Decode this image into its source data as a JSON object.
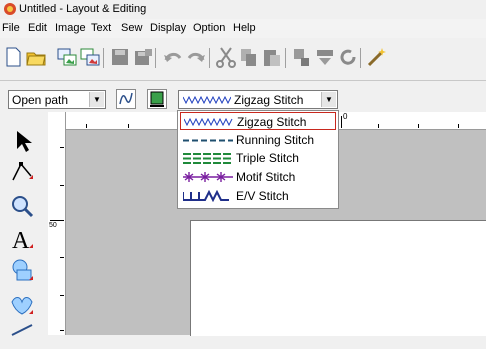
{
  "window": {
    "title": "Untitled - Layout & Editing"
  },
  "menu": [
    "File",
    "Edit",
    "Image",
    "Text",
    "Sew",
    "Display",
    "Option",
    "Help"
  ],
  "toolbar2": {
    "path_mode": "Open path",
    "stitch_selected": "Zigzag Stitch"
  },
  "stitch_options": [
    {
      "label": "Zigzag Stitch",
      "icon": "zigzag-pattern"
    },
    {
      "label": "Running Stitch",
      "icon": "dashed-line-pattern"
    },
    {
      "label": "Triple Stitch",
      "icon": "triple-line-pattern"
    },
    {
      "label": "Motif Stitch",
      "icon": "motif-star-pattern"
    },
    {
      "label": "E/V Stitch",
      "icon": "ev-pattern"
    }
  ],
  "ruler": {
    "unit": "mm",
    "top_label": "0",
    "left_label": "50"
  },
  "colors": {
    "selected_border": "#c8281e",
    "stitch_line": "#1f3fbf",
    "motif": "#7a1fa0",
    "triple": "#1f8a3a"
  }
}
